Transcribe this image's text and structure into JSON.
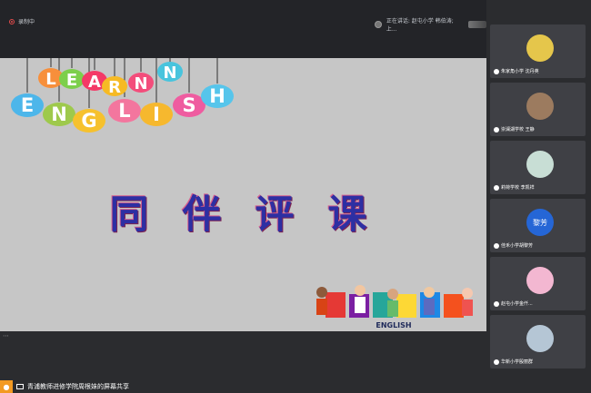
{
  "header": {
    "recording_label": "录制中",
    "speaking_label": "正在讲话: 赵屯小学 韩伯涛; 上..."
  },
  "slide": {
    "title": "同 伴 评 课",
    "learn_letters": [
      "L",
      "E",
      "A",
      "R",
      "N"
    ],
    "english_letters": [
      "E",
      "N",
      "G",
      "L",
      "I",
      "S",
      "H"
    ],
    "bottom_word": "ENGLISH"
  },
  "sidebar": {
    "participants": [
      {
        "name": "朱家角小学 沈丹英",
        "avatar_type": "photo",
        "avatar_color": "#e5c64b"
      },
      {
        "name": "崇澜湖学校 王静",
        "avatar_type": "photo",
        "avatar_color": "#9c7b5f"
      },
      {
        "name": "莉荷学校 李凯祥",
        "avatar_type": "cartoon",
        "avatar_color": "#c8ded5"
      },
      {
        "name": "佳禾小学胡黎芳",
        "avatar_type": "initials",
        "avatar_initials": "黎芳",
        "avatar_color": "#2566d6"
      },
      {
        "name": "赵屯小学金仟...",
        "avatar_type": "photo",
        "avatar_color": "#f3b7d1"
      },
      {
        "name": "华新小学殷丽群",
        "avatar_type": "photo",
        "avatar_color": "#b5c6d5"
      }
    ]
  },
  "footer": {
    "more_icon": "⋯",
    "share_text": "青浦教师进修学院周根妹的屏幕共享"
  }
}
